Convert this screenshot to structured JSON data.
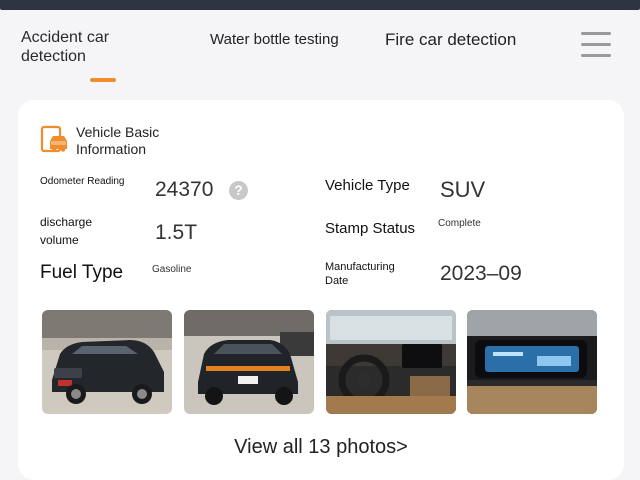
{
  "tabs": [
    {
      "label": "Accident car detection",
      "active": true
    },
    {
      "label": "Water bottle testing",
      "active": false
    },
    {
      "label": "Fire car detection",
      "active": false
    }
  ],
  "menu_icon": "hamburger-menu-icon",
  "accent_color": "#f08c2b",
  "section": {
    "icon": "car-document-icon",
    "title": "Vehicle Basic Information"
  },
  "fields": {
    "odometer": {
      "label": "Odometer Reading",
      "value": "24370"
    },
    "vehicle_type": {
      "label": "Vehicle Type",
      "value": "SUV"
    },
    "discharge": {
      "label": "discharge volume",
      "value": "1.5T"
    },
    "stamp_status": {
      "label": "Stamp Status",
      "value": "Complete"
    },
    "fuel_type": {
      "label": "Fuel Type",
      "value": "Gasoline"
    },
    "manufacturing_date": {
      "label": "Manufacturing Date",
      "value": "2023–09"
    }
  },
  "help_icon": "question-icon",
  "photos": [
    {
      "name": "car-front-photo"
    },
    {
      "name": "car-rear-photo"
    },
    {
      "name": "car-interior-photo"
    },
    {
      "name": "car-dashboard-photo"
    }
  ],
  "view_all_label": "View all 13 photos>"
}
